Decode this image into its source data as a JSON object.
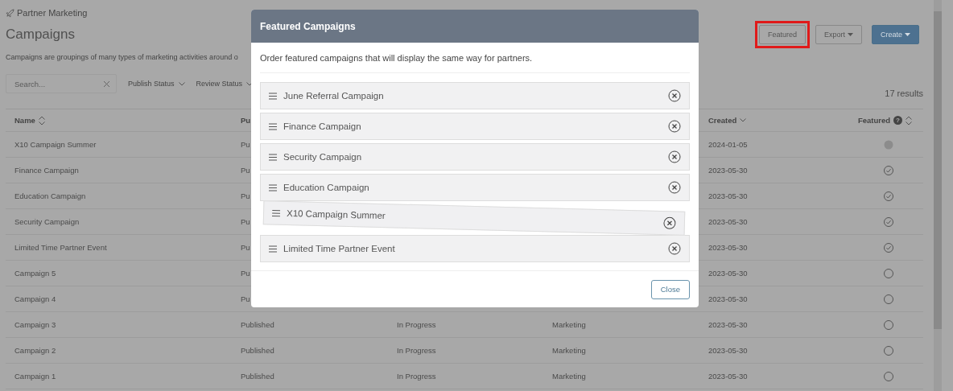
{
  "breadcrumb": "Partner Marketing",
  "title": "Campaigns",
  "description": "Campaigns are groupings of many types of marketing activities around o",
  "actions": [
    {
      "label": "Featured",
      "kind": "plain",
      "highlighted": true
    },
    {
      "label": "Export",
      "kind": "dropdown",
      "highlighted": false
    },
    {
      "label": "Create",
      "kind": "primary",
      "highlighted": false
    }
  ],
  "search": {
    "placeholder": "Search..."
  },
  "filters": [
    "Publish Status",
    "Review Status"
  ],
  "results": "17 results",
  "table": {
    "columns": [
      {
        "label": "Name",
        "sortable": true,
        "sorted": false
      },
      {
        "label": "Pu"
      },
      null,
      null,
      {
        "label": "Created",
        "sortable": false,
        "sorted": true
      },
      {
        "label": "Featured",
        "sortable": true,
        "sorted": false,
        "help": "?"
      }
    ],
    "rows": [
      {
        "cells": [
          "X10 Campaign Summer",
          "Pu",
          null,
          null,
          "2024-01-05"
        ],
        "featured": false,
        "hovered": true
      },
      {
        "cells": [
          "Finance Campaign",
          "Pu",
          null,
          null,
          "2023-05-30"
        ],
        "featured": true,
        "hovered": false
      },
      {
        "cells": [
          "Education Campaign",
          "Pu",
          null,
          null,
          "2023-05-30"
        ],
        "featured": true,
        "hovered": false
      },
      {
        "cells": [
          "Security Campaign",
          "Pu",
          null,
          null,
          "2023-05-30"
        ],
        "featured": true,
        "hovered": false
      },
      {
        "cells": [
          "Limited Time Partner Event",
          "Pu",
          null,
          null,
          "2023-05-30"
        ],
        "featured": true,
        "hovered": false
      },
      {
        "cells": [
          "Campaign 5",
          "Pu",
          null,
          null,
          "2023-05-30"
        ],
        "featured": false,
        "hovered": false
      },
      {
        "cells": [
          "Campaign 4",
          "Pu",
          null,
          null,
          "2023-05-30"
        ],
        "featured": false,
        "hovered": false
      },
      {
        "cells": [
          "Campaign 3",
          "Published",
          "In Progress",
          "Marketing",
          "2023-05-30"
        ],
        "featured": false,
        "hovered": false
      },
      {
        "cells": [
          "Campaign 2",
          "Published",
          "In Progress",
          "Marketing",
          "2023-05-30"
        ],
        "featured": false,
        "hovered": false
      },
      {
        "cells": [
          "Campaign 1",
          "Published",
          "In Progress",
          "Marketing",
          "2023-05-30"
        ],
        "featured": false,
        "hovered": false
      }
    ]
  },
  "modal": {
    "title": "Featured Campaigns",
    "text": "Order featured campaigns that will display the same way for partners.",
    "items": [
      {
        "label": "June Referral Campaign",
        "dragging": false
      },
      {
        "label": "Finance Campaign",
        "dragging": false
      },
      {
        "label": "Security Campaign",
        "dragging": false
      },
      {
        "label": "Education Campaign",
        "dragging": false
      },
      {
        "label": "X10 Campaign Summer",
        "dragging": true
      },
      {
        "label": "Limited Time Partner Event",
        "dragging": false
      }
    ],
    "close": "Close"
  }
}
